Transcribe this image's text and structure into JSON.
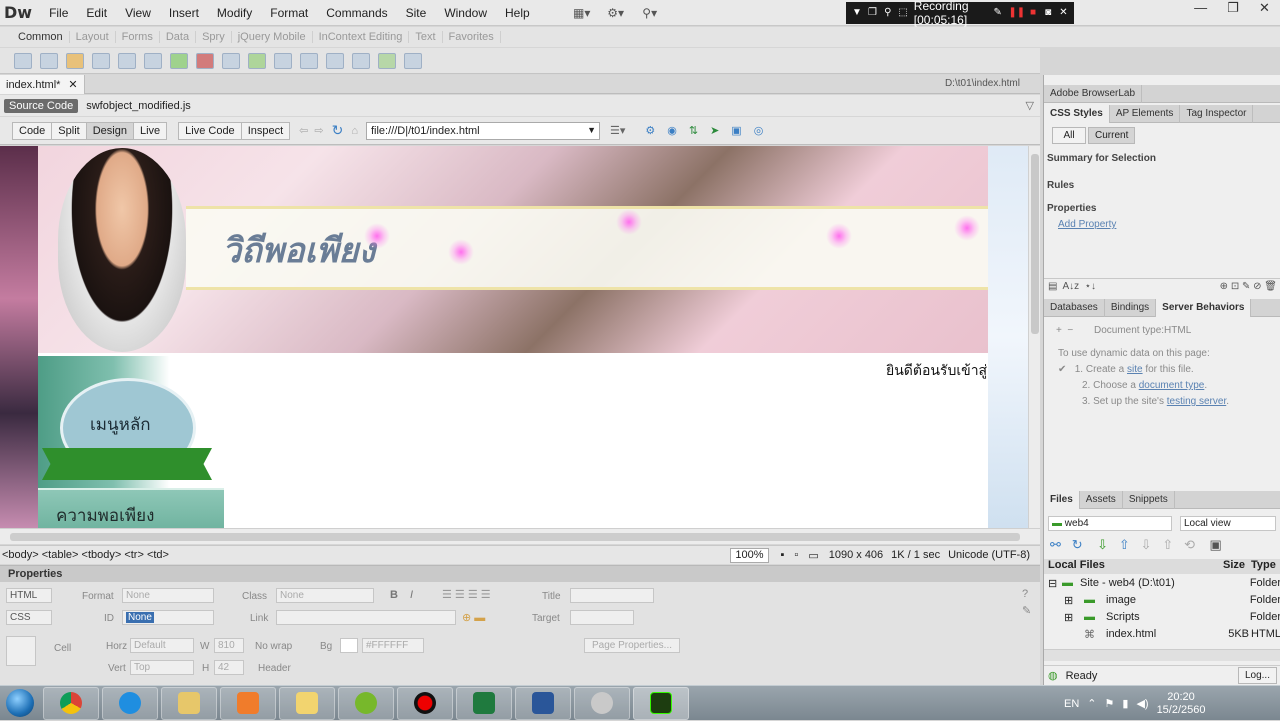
{
  "menubar": {
    "app_logo": "Dw",
    "items": [
      "File",
      "Edit",
      "View",
      "Insert",
      "Modify",
      "Format",
      "Commands",
      "Site",
      "Window",
      "Help"
    ]
  },
  "recorder": {
    "label": "Recording [00:05:16]"
  },
  "insert_bar": {
    "tabs": [
      "Common",
      "Layout",
      "Forms",
      "Data",
      "Spry",
      "jQuery Mobile",
      "InContext Editing",
      "Text",
      "Favorites"
    ]
  },
  "document": {
    "tab_label": "index.html*",
    "path": "D:\\t01\\index.html",
    "source_code_label": "Source Code",
    "related_file": "swfobject_modified.js"
  },
  "view_bar": {
    "buttons": [
      "Code",
      "Split",
      "Design",
      "Live"
    ],
    "live_code": "Live Code",
    "inspect": "Inspect",
    "address": "file:///D|/t01/index.html"
  },
  "page": {
    "site_title": "วิถีพอเพียง",
    "welcome_text": "ยินดีต้อนรับเข้าสู่",
    "menu_title": "เมนูหลัก",
    "menu_item": "ความพอเพียง"
  },
  "status_bar": {
    "tag_selector": "<body> <table> <tbody> <tr> <td>",
    "zoom": "100%",
    "dimensions": "1090 x 406",
    "download": "1K / 1 sec",
    "encoding": "Unicode (UTF-8)"
  },
  "properties": {
    "title": "Properties",
    "html_btn": "HTML",
    "css_btn": "CSS",
    "format_label": "Format",
    "format_value": "None",
    "class_label": "Class",
    "class_value": "None",
    "id_label": "ID",
    "id_value": "None",
    "link_label": "Link",
    "title_label": "Title",
    "target_label": "Target",
    "cell_label": "Cell",
    "horz_label": "Horz",
    "horz_value": "Default",
    "vert_label": "Vert",
    "vert_value": "Top",
    "w_label": "W",
    "w_value": "810",
    "h_label": "H",
    "h_value": "42",
    "nowrap_label": "No wrap",
    "header_label": "Header",
    "bg_label": "Bg",
    "bg_value": "#FFFFFF",
    "page_props": "Page Properties..."
  },
  "right_panel": {
    "browserlab": "Adobe BrowserLab",
    "css_tabs": [
      "CSS Styles",
      "AP Elements",
      "Tag Inspector"
    ],
    "all_btn": "All",
    "current_btn": "Current",
    "summary": "Summary for Selection",
    "rules": "Rules",
    "properties": "Properties",
    "add_property": "Add Property",
    "server_tabs": [
      "Databases",
      "Bindings",
      "Server Behaviors"
    ],
    "doc_type": "Document type:HTML",
    "dyn_intro": "To use dynamic data on this page:",
    "step1_pre": "1.  Create a ",
    "step1_link": "site",
    "step1_post": " for this file.",
    "step2_pre": "2.  Choose a ",
    "step2_link": "document type",
    "step2_post": ".",
    "step3_pre": "3.  Set up the site's ",
    "step3_link": "testing server",
    "step3_post": ".",
    "files_tabs": [
      "Files",
      "Assets",
      "Snippets"
    ],
    "site_select": "web4",
    "view_select": "Local view",
    "local_files": "Local Files",
    "size_col": "Size",
    "type_col": "Type",
    "files": [
      {
        "name": "Site - web4 (D:\\t01)",
        "size": "",
        "type": "Folder"
      },
      {
        "name": "image",
        "size": "",
        "type": "Folder"
      },
      {
        "name": "Scripts",
        "size": "",
        "type": "Folder"
      },
      {
        "name": "index.html",
        "size": "5KB",
        "type": "HTML"
      }
    ],
    "ready": "Ready",
    "log_btn": "Log..."
  },
  "taskbar": {
    "lang": "EN",
    "time": "20:20",
    "date": "15/2/2560",
    "apps": [
      "chrome-icon",
      "ie-icon",
      "explorer-icon",
      "media-player-icon",
      "folder-icon",
      "utorrent-icon",
      "record-icon",
      "excel-icon",
      "word-icon",
      "disc-icon",
      "dreamweaver-icon"
    ]
  },
  "colors": {
    "accent": "#2f8f2c",
    "dw_green": "#35fa00",
    "recorder_bg": "#1a1a1a"
  }
}
